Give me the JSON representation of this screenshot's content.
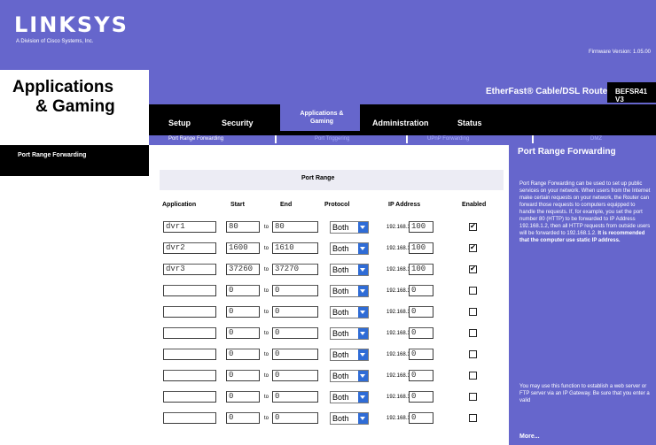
{
  "brand": {
    "logo": "LINKSYS",
    "tagline": "A Division of Cisco Systems, Inc."
  },
  "firmware": "Firmware Version: 1.05.00",
  "page_title_1": "Applications",
  "page_title_2": "& Gaming",
  "product_name": "EtherFast® Cable/DSL Router",
  "model": "BEFSR41 V3",
  "nav": [
    {
      "label": "Setup"
    },
    {
      "label": "Security"
    },
    {
      "label": "Applications & Gaming",
      "active": true
    },
    {
      "label": "Administration"
    },
    {
      "label": "Status"
    }
  ],
  "subnav": [
    "Port Range Forwarding",
    "Port Triggering",
    "UPnP Forwarding",
    "DMZ"
  ],
  "sidebar_label": "Port Range Forwarding",
  "table": {
    "group_header": "Port Range",
    "headers": [
      "Application",
      "Start",
      "End",
      "Protocol",
      "IP Address",
      "Enabled"
    ],
    "to_label": "to",
    "ip_prefix": "192.168.1.",
    "rows": [
      {
        "app": "dvr1",
        "start": "80",
        "end": "80",
        "protocol": "Both",
        "ip": "100",
        "enabled": true
      },
      {
        "app": "dvr2",
        "start": "1600",
        "end": "1610",
        "protocol": "Both",
        "ip": "100",
        "enabled": true
      },
      {
        "app": "dvr3",
        "start": "37260",
        "end": "37270",
        "protocol": "Both",
        "ip": "100",
        "enabled": true
      },
      {
        "app": "",
        "start": "0",
        "end": "0",
        "protocol": "Both",
        "ip": "0",
        "enabled": false
      },
      {
        "app": "",
        "start": "0",
        "end": "0",
        "protocol": "Both",
        "ip": "0",
        "enabled": false
      },
      {
        "app": "",
        "start": "0",
        "end": "0",
        "protocol": "Both",
        "ip": "0",
        "enabled": false
      },
      {
        "app": "",
        "start": "0",
        "end": "0",
        "protocol": "Both",
        "ip": "0",
        "enabled": false
      },
      {
        "app": "",
        "start": "0",
        "end": "0",
        "protocol": "Both",
        "ip": "0",
        "enabled": false
      },
      {
        "app": "",
        "start": "0",
        "end": "0",
        "protocol": "Both",
        "ip": "0",
        "enabled": false
      },
      {
        "app": "",
        "start": "0",
        "end": "0",
        "protocol": "Both",
        "ip": "0",
        "enabled": false
      }
    ]
  },
  "help": {
    "title": "Port Range Forwarding",
    "body": "Port Range Forwarding can be used to set up public services on your network. When users from the Internet make certain requests on your network, the Router can forward those requests to computers equipped to handle the requests. If, for example, you set the port number 80 (HTTP) to be forwarded to IP Address 192.168.1.2, then all HTTP requests from outside users will be forwarded to 192.168.1.2.",
    "bold": "It is recommended that the computer use static IP address.",
    "body2": "You may use this function to establish a web server or FTP server via an IP Gateway. Be sure that you enter a valid",
    "more": "More..."
  },
  "colors": {
    "accent": "#6666cc",
    "bar": "#000000",
    "select_button": "#2f6cd6"
  },
  "icons": {
    "checkbox_checked": "check-icon",
    "dropdown": "chevron-down-icon"
  }
}
